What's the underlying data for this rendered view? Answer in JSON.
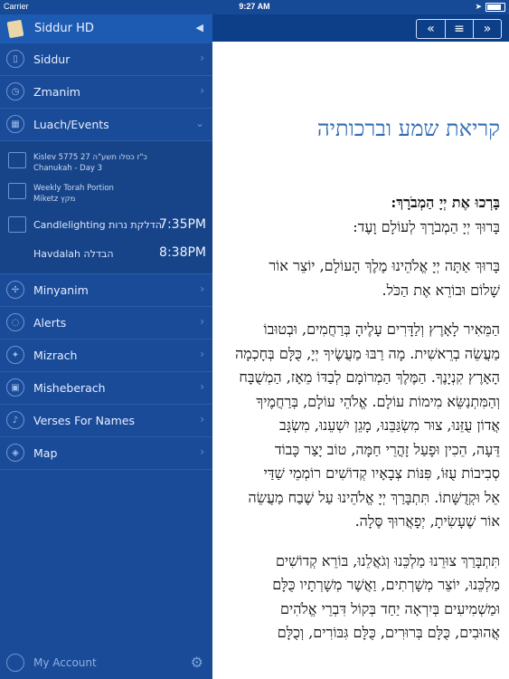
{
  "status": {
    "carrier": "Carrier",
    "time": "9:27 AM"
  },
  "sidebar": {
    "app_title": "Siddur HD",
    "items": [
      {
        "label": "Siddur",
        "icon": "book-icon"
      },
      {
        "label": "Zmanim",
        "icon": "clock-icon"
      },
      {
        "label": "Luach/Events",
        "icon": "calendar-icon",
        "expanded": true
      }
    ],
    "luach": {
      "date_line1": "Kislev 5775 27  כ\"ז כסלו תשע\"ה",
      "date_line2": "Chanukah - Day 3",
      "torah_line1": "Weekly Torah Portion",
      "torah_line2": "Miketz  מקץ",
      "candle_label": "Candlelighting  הדלקת נרות",
      "candle_time": "7:35PM",
      "havdalah_label": "Havdalah  הבדלה",
      "havdalah_time": "8:38PM"
    },
    "items2": [
      {
        "label": "Minyanim",
        "icon": "compass-icon"
      },
      {
        "label": "Alerts",
        "icon": "chat-bubble-icon"
      },
      {
        "label": "Mizrach",
        "icon": "star-compass-icon"
      },
      {
        "label": "Misheberach",
        "icon": "scroll-icon"
      },
      {
        "label": "Verses For Names",
        "icon": "music-note-icon"
      },
      {
        "label": "Map",
        "icon": "map-icon"
      }
    ],
    "footer_label": "My Account"
  },
  "toolbar": {
    "prev": "«",
    "list": "≡",
    "next": "»"
  },
  "prayer": {
    "title": "קריאת שמע וברכותיה",
    "p1": [
      "בָּרְכוּ אֶת יְיָ הַמְבֹרָךְ:",
      "בָּרוּךְ יְיָ הַמְבֹרָךְ לְעוֹלָם וָעֶד:"
    ],
    "p2": [
      "בָּרוּךְ אַתָּה יְיָ אֱלֹהֵינוּ מֶלֶךְ הָעוֹלָם, יוֹצֵר אוֹר",
      "שָׁלוֹם וּבוֹרֵא אֶת הַכֹּל."
    ],
    "p3": [
      "הַמֵּאִיר לָאָרֶץ וְלַדָּרִים עָלֶיהָ בְּרַחֲמִים, וּבְטוּבוֹ",
      "מַעֲשֵׂה בְרֵאשִׁית. מָה רַבּוּ מַעֲשֶׂיךָ יְיָ, כֻּלָּם בְּחָכְמָה",
      "הָאָרֶץ קִנְיָנֶךָ. הַמֶּלֶךְ הַמְרוֹמָם לְבַדּוֹ מֵאָז, הַמְשֻׁבָּח",
      "וְהַמִּתְנַשֵּׂא מִימוֹת עוֹלָם. אֱלֹהֵי עוֹלָם, בְּרַחֲמֶיךָ",
      "אֲדוֹן עֻזֵּנוּ, צוּר מִשְׂגַּבֵּנוּ, מָגֵן יִשְׁעֵנוּ, מִשְׂגָּב",
      "דֵּעָה, הֵכִין וּפָעַל זָהֳרֵי חַמָּה, טוֹב יָצַר כָּבוֹד",
      "סְבִיבוֹת עֻזּוֹ, פִּנּוֹת צְבָאָיו קְדוֹשִׁים רוֹמְמֵי שַׁדַּי",
      "אֵל וּקְדֻשָּׁתוֹ. תִּתְבָּרַךְ יְיָ אֱלֹהֵינוּ עַל שֶׁבַח מַעֲשֵׂה",
      "אוֹר שֶׁעָשִׂיתָ, יְפָאֲרוּךָ סֶּלָה."
    ],
    "p4": [
      "תִּתְבָּרַךְ צוּרֵנוּ מַלְכֵּנוּ וְגֹאֲלֵנוּ, בּוֹרֵא קְדוֹשִׁים",
      "מַלְכֵּנוּ, יוֹצֵר מְשָׁרְתִים, וַאֲשֶׁר מְשָׁרְתָיו כֻּלָּם",
      "וּמַשְׁמִיעִים בְּיִרְאָה יַחַד בְּקוֹל דִּבְרֵי אֱלֹהִים",
      "אֲהוּבִים, כֻּלָּם בְּרוּרִים, כֻּלָּם גִּבּוֹרִים, וְכֻלָּם"
    ]
  }
}
